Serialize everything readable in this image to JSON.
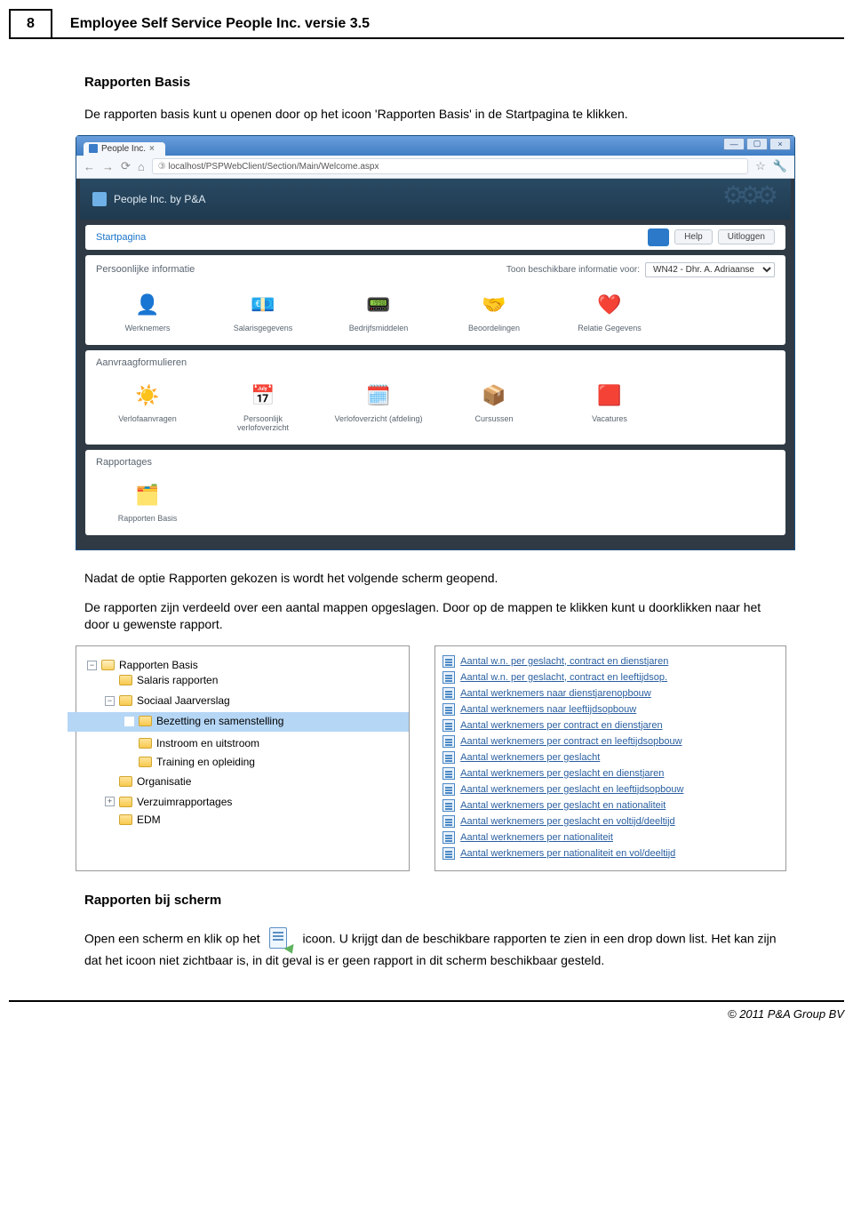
{
  "page": {
    "number": "8",
    "header_title": "Employee Self Service People Inc. versie 3.5",
    "footer": "© 2011 P&A Group BV"
  },
  "section": {
    "title": "Rapporten Basis",
    "intro": "De rapporten basis kunt u openen door op het icoon 'Rapporten Basis' in de Startpagina te klikken.",
    "after_screenshot_1": "Nadat de optie Rapporten gekozen is wordt het volgende scherm geopend.",
    "after_screenshot_2": "De rapporten zijn verdeeld over een aantal mappen opgeslagen. Door op de mappen te klikken kunt u doorklikken naar het door u gewenste rapport.",
    "subtitle": "Rapporten bij scherm",
    "p3_before": "Open een scherm en klik op het ",
    "p3_after": " icoon. U krijgt dan de beschikbare rapporten te zien in een drop down list. Het kan zijn dat het icoon niet zichtbaar is, in dit geval is er geen rapport in dit scherm beschikbaar gesteld."
  },
  "browser": {
    "tab_title": "People Inc.",
    "url": "localhost/PSPWebClient/Section/Main/Welcome.aspx",
    "app_title": "People Inc. by P&A",
    "nav_link": "Startpagina",
    "help_label": "Help",
    "logout_label": "Uitloggen",
    "panel1": {
      "title": "Persoonlijke informatie",
      "filter_label": "Toon beschikbare informatie voor:",
      "filter_value": "WN42 - Dhr. A. Adriaanse",
      "icons": [
        {
          "glyph": "👤",
          "label": "Werknemers"
        },
        {
          "glyph": "💶",
          "label": "Salarisgegevens"
        },
        {
          "glyph": "📟",
          "label": "Bedrijfsmiddelen"
        },
        {
          "glyph": "🤝",
          "label": "Beoordelingen"
        },
        {
          "glyph": "❤️",
          "label": "Relatie Gegevens"
        }
      ]
    },
    "panel2": {
      "title": "Aanvraagformulieren",
      "icons": [
        {
          "glyph": "☀️",
          "label": "Verlofaanvragen"
        },
        {
          "glyph": "📅",
          "label": "Persoonlijk verlofoverzicht"
        },
        {
          "glyph": "🗓️",
          "label": "Verlofoverzicht (afdeling)"
        },
        {
          "glyph": "📦",
          "label": "Cursussen"
        },
        {
          "glyph": "🟥",
          "label": "Vacatures"
        }
      ]
    },
    "panel3": {
      "title": "Rapportages",
      "icons": [
        {
          "glyph": "🗂️",
          "label": "Rapporten Basis"
        }
      ]
    }
  },
  "tree": {
    "root": "Rapporten Basis",
    "items": [
      {
        "label": "Salaris rapporten",
        "toggle": "",
        "depth": 1
      },
      {
        "label": "Sociaal Jaarverslag",
        "toggle": "−",
        "depth": 1
      },
      {
        "label": "Bezetting en samenstelling",
        "toggle": "",
        "depth": 2,
        "selected": true
      },
      {
        "label": "Instroom en uitstroom",
        "toggle": "",
        "depth": 2
      },
      {
        "label": "Training en opleiding",
        "toggle": "",
        "depth": 2
      },
      {
        "label": "Organisatie",
        "toggle": "",
        "depth": 1
      },
      {
        "label": "Verzuimrapportages",
        "toggle": "+",
        "depth": 1
      },
      {
        "label": "EDM",
        "toggle": "",
        "depth": 1
      }
    ]
  },
  "reports": [
    "Aantal w.n. per geslacht, contract en dienstjaren",
    "Aantal w.n. per geslacht, contract en leeftijdsop.",
    "Aantal werknemers naar dienstjarenopbouw",
    "Aantal werknemers naar leeftijdsopbouw",
    "Aantal werknemers per contract en dienstjaren",
    "Aantal werknemers per contract en leeftijdsopbouw",
    "Aantal werknemers per geslacht",
    "Aantal werknemers per geslacht en dienstjaren",
    "Aantal werknemers per geslacht en leeftijdsopbouw",
    "Aantal werknemers per geslacht en nationaliteit",
    "Aantal werknemers per geslacht en voltijd/deeltijd",
    "Aantal werknemers per nationaliteit",
    "Aantal werknemers per nationaliteit en vol/deeltijd"
  ]
}
